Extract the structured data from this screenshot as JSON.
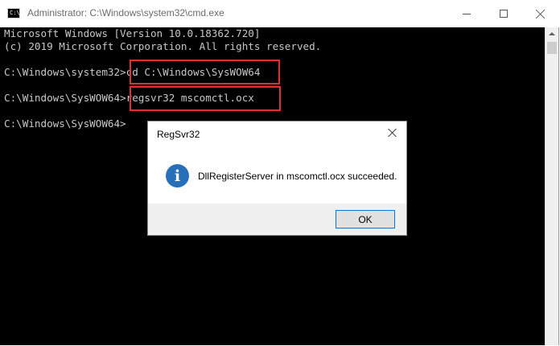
{
  "window": {
    "title": "Administrator: C:\\Windows\\system32\\cmd.exe",
    "icon_label": "C:\\_"
  },
  "console": {
    "lines": [
      "Microsoft Windows [Version 10.0.18362.720]",
      "(c) 2019 Microsoft Corporation. All rights reserved.",
      "C:\\Windows\\system32>cd C:\\Windows\\SysWOW64",
      "C:\\Windows\\SysWOW64>regsvr32 mscomctl.ocx",
      "C:\\Windows\\SysWOW64>"
    ],
    "highlight_color": "#e0312f"
  },
  "dialog": {
    "title": "RegSvr32",
    "message": "DllRegisterServer in mscomctl.ocx succeeded.",
    "info_glyph": "i",
    "ok_label": "OK"
  },
  "colors": {
    "console_bg": "#000000",
    "console_text": "#c8c8c8",
    "info_blue": "#2770b9",
    "button_focus": "#0078d7"
  }
}
